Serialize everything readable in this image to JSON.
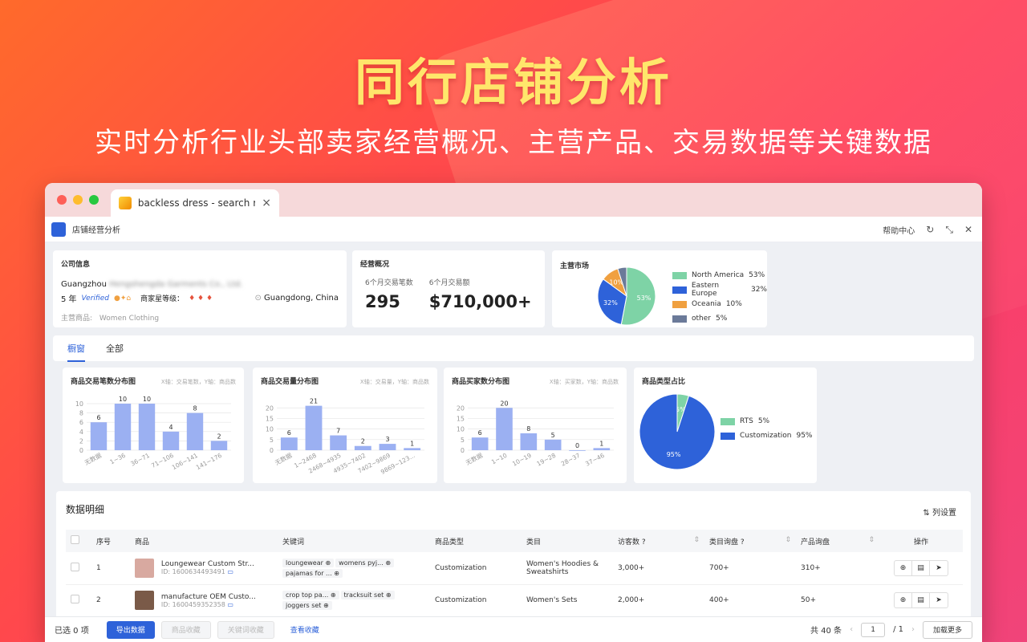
{
  "hero": {
    "title": "同行店铺分析",
    "subtitle": "实时分析行业头部卖家经营概况、主营产品、交易数据等关键数据"
  },
  "browser": {
    "tab_title": "backless dress - search re"
  },
  "app": {
    "title": "店铺经营分析",
    "help": "帮助中心"
  },
  "company": {
    "section_title": "公司信息",
    "name_prefix": "Guangzhou",
    "name_blurred": "Hengshengda Garments Co., Ltd.",
    "years": "5 年",
    "verified": "Verified",
    "star_label": "商家星等级：",
    "location": "Guangdong, China",
    "main_products_label": "主营商品:",
    "main_products": "Women Clothing"
  },
  "overview": {
    "section_title": "经营概况",
    "orders_label": "6个月交易笔数",
    "orders_value": "295",
    "amount_label": "6个月交易额",
    "amount_value": "$710,000+"
  },
  "market": {
    "section_title": "主营市场",
    "legend": [
      {
        "name": "North America",
        "pct": "53%",
        "color": "#7ed3a6"
      },
      {
        "name": "Eastern Europe",
        "pct": "32%",
        "color": "#2e62d9"
      },
      {
        "name": "Oceania",
        "pct": "10%",
        "color": "#f0a040"
      },
      {
        "name": "other",
        "pct": "5%",
        "color": "#6b7a99"
      }
    ]
  },
  "tabs": [
    "橱窗",
    "全部"
  ],
  "chart_data": [
    {
      "type": "bar",
      "title": "商品交易笔数分布图",
      "note": "X轴：交易笔数，Y轴：商品数",
      "categories": [
        "无数据",
        "1~36",
        "36~71",
        "71~106",
        "106~141",
        "141~176"
      ],
      "values": [
        6,
        10,
        10,
        4,
        8,
        2
      ],
      "yticks": [
        0,
        2,
        4,
        6,
        8,
        10
      ],
      "ylim": [
        0,
        10
      ]
    },
    {
      "type": "bar",
      "title": "商品交易量分布图",
      "note": "X轴：交易量，Y轴：商品数",
      "categories": [
        "无数据",
        "1~2468",
        "2468~4935",
        "4935~7402",
        "7402~9869",
        "9869~123..."
      ],
      "values": [
        6,
        21,
        7,
        2,
        3,
        1
      ],
      "yticks": [
        0,
        5,
        10,
        15,
        20
      ],
      "ylim": [
        0,
        22
      ]
    },
    {
      "type": "bar",
      "title": "商品买家数分布图",
      "note": "X轴：买家数，Y轴：商品数",
      "categories": [
        "无数据",
        "1~10",
        "10~19",
        "19~28",
        "28~37",
        "37~46"
      ],
      "values": [
        6,
        20,
        8,
        5,
        0,
        1
      ],
      "yticks": [
        0,
        5,
        10,
        15,
        20
      ],
      "ylim": [
        0,
        22
      ]
    },
    {
      "type": "pie",
      "title": "商品类型占比",
      "slices": [
        {
          "name": "RTS",
          "value": 5,
          "label": "5%",
          "color": "#7ed3a6"
        },
        {
          "name": "Customization",
          "value": 95,
          "label": "95%",
          "color": "#2e62d9"
        }
      ]
    }
  ],
  "market_pie": [
    {
      "name": "North America",
      "value": 53,
      "label": "53%",
      "color": "#7ed3a6"
    },
    {
      "name": "Eastern Europe",
      "value": 32,
      "label": "32%",
      "color": "#2e62d9"
    },
    {
      "name": "Oceania",
      "value": 10,
      "label": "10%",
      "color": "#f0a040"
    },
    {
      "name": "other",
      "value": 5,
      "label": "",
      "color": "#6b7a99"
    }
  ],
  "detail": {
    "title": "数据明细",
    "column_settings": "列设置",
    "headers": [
      "",
      "序号",
      "商品",
      "关键词",
      "商品类型",
      "类目",
      "访客数",
      "类目询盘",
      "产品询盘",
      "操作"
    ],
    "rows": [
      {
        "index": "1",
        "name": "Loungewear Custom Str...",
        "id": "ID: 1600634493491",
        "keywords": [
          "loungewear",
          "womens pyj...",
          "pajamas for ..."
        ],
        "type": "Customization",
        "category": "Women's Hoodies & Sweatshirts",
        "visitors": "3,000+",
        "cat_inquiry": "700+",
        "prod_inquiry": "310+",
        "thumb_color": "#d8a9a0"
      },
      {
        "index": "2",
        "name": "manufacture OEM Custo...",
        "id": "ID: 1600459352358",
        "keywords": [
          "crop top pa...",
          "tracksuit set",
          "joggers set"
        ],
        "type": "Customization",
        "category": "Women's Sets",
        "visitors": "2,000+",
        "cat_inquiry": "400+",
        "prod_inquiry": "50+",
        "thumb_color": "#7a5a48"
      }
    ]
  },
  "footer": {
    "selected": "已选 0 项",
    "export": "导出数据",
    "fav_products": "商品收藏",
    "fav_keywords": "关键词收藏",
    "view_favs": "查看收藏",
    "total": "共 40 条",
    "page": "1",
    "pages": "/ 1",
    "load_more": "加载更多"
  }
}
